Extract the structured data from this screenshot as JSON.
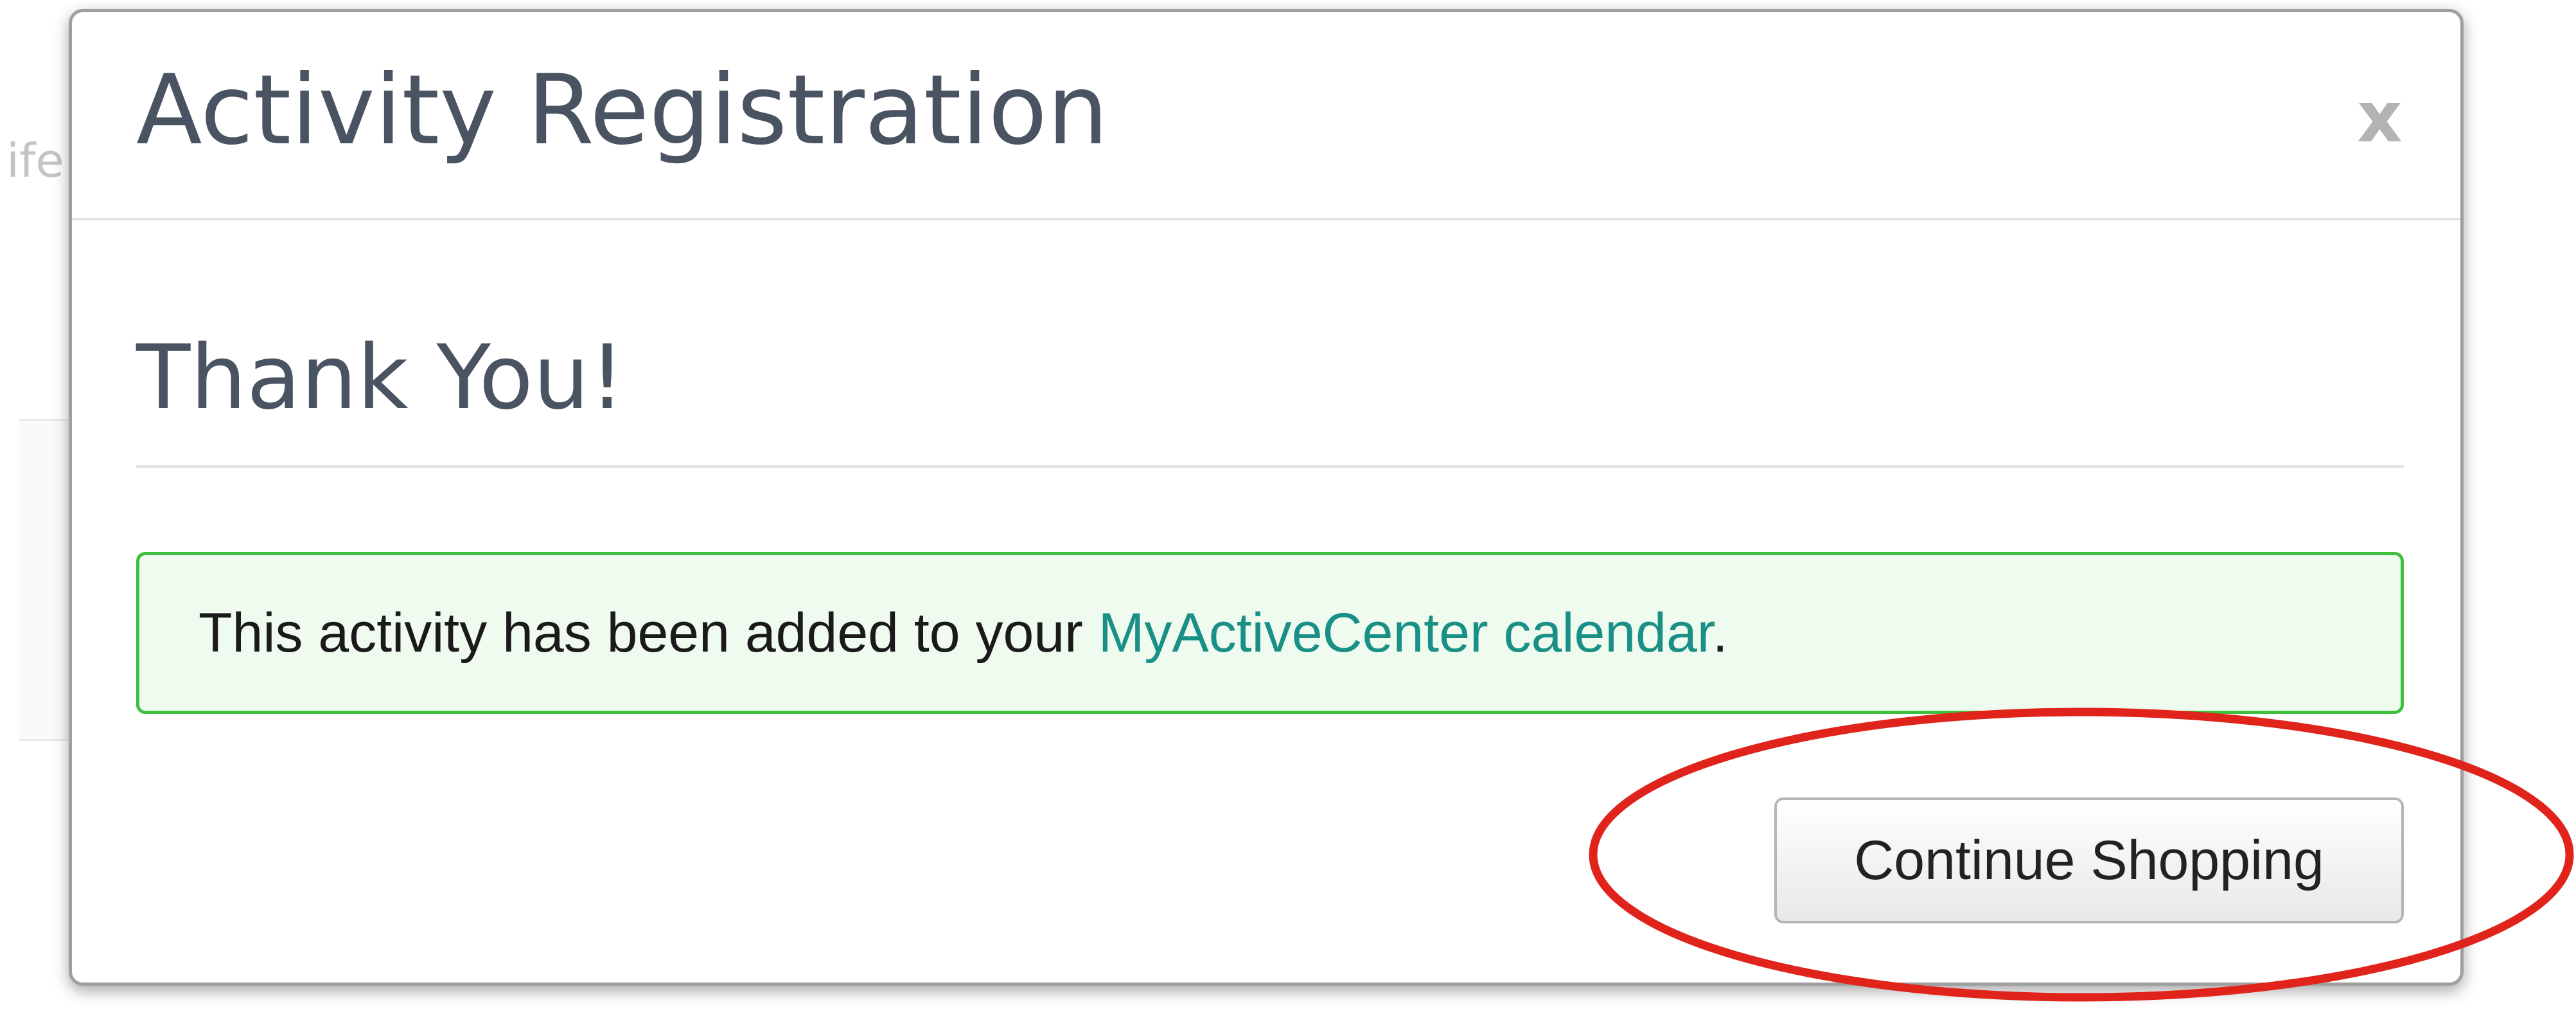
{
  "background": {
    "partial_text": "ife"
  },
  "modal": {
    "title": "Activity Registration",
    "close_label": "x",
    "heading": "Thank You!",
    "alert": {
      "text_before": "This activity has been added to your ",
      "link_text": "MyActiveCenter calendar",
      "text_after": "."
    },
    "continue_label": "Continue Shopping"
  },
  "colors": {
    "annotation": "#e0241b",
    "alert_border": "#3fbf3f",
    "alert_background": "#eefbee",
    "link": "#1a8f86"
  },
  "icons": {
    "close": "close-icon"
  }
}
